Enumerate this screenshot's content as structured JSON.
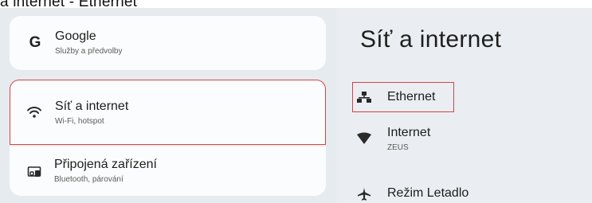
{
  "caption": "a internet - Ethernet",
  "sidebar": {
    "items": [
      {
        "title": "Google",
        "subtitle": "Služby a předvolby",
        "icon": "google-icon",
        "icon_glyph": "G"
      },
      {
        "title": "Síť a internet",
        "subtitle": "Wi-Fi, hotspot",
        "icon": "wifi-icon"
      },
      {
        "title": "Připojená zařízení",
        "subtitle": "Bluetooth, párování",
        "icon": "devices-icon"
      }
    ]
  },
  "detail": {
    "title": "Síť a internet",
    "items": [
      {
        "title": "Ethernet",
        "subtitle": "",
        "icon": "ethernet-icon"
      },
      {
        "title": "Internet",
        "subtitle": "ZEUS",
        "icon": "signal-icon"
      },
      {
        "title": "Režim Letadlo",
        "subtitle": "",
        "icon": "airplane-icon"
      }
    ]
  },
  "colors": {
    "background": "#e6ebf0",
    "card": "#fbfcfd",
    "highlight": "#d64541",
    "text": "#1d1d1d"
  }
}
